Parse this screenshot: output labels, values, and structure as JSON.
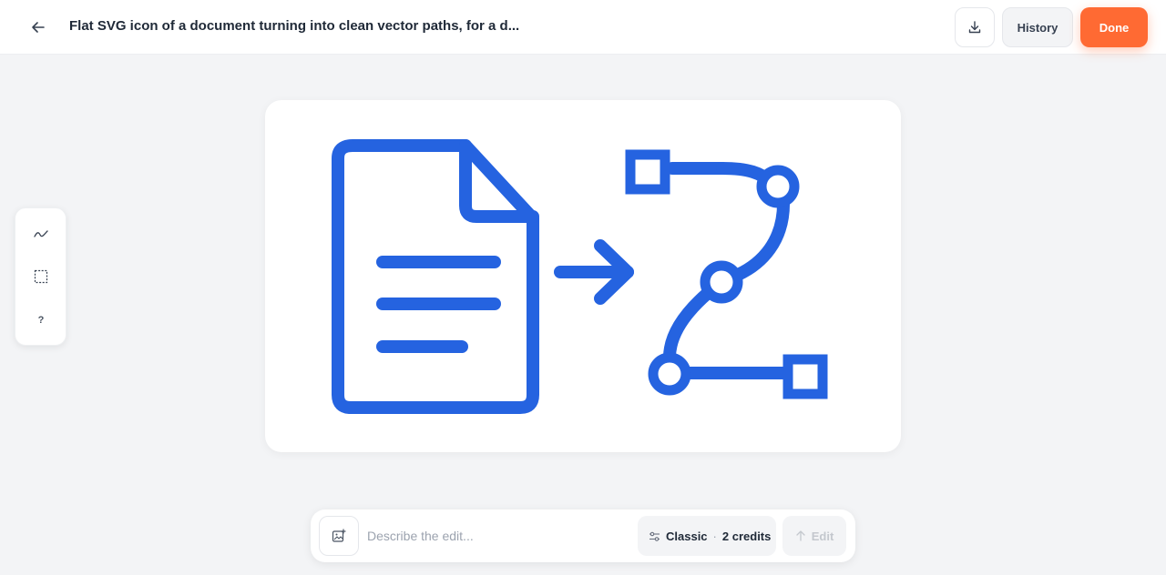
{
  "header": {
    "title": "Flat SVG icon of a document turning into clean vector paths, for a d...",
    "history_label": "History",
    "done_label": "Done"
  },
  "icons": {
    "back": "arrow-left-icon",
    "download": "download-icon",
    "path_tool": "path-tool-icon",
    "select_tool": "marquee-select-icon",
    "help": "help-icon",
    "attach": "image-add-icon",
    "mode": "sliders-icon",
    "submit": "arrow-up-icon"
  },
  "toolbar": {
    "help_label": "?"
  },
  "editbar": {
    "placeholder": "Describe the edit...",
    "mode_label": "Classic",
    "separator": "·",
    "credits_label": "2 credits",
    "submit_label": "Edit"
  },
  "colors": {
    "accent": "#ff6a33",
    "artwork_blue": "#2563e0",
    "background": "#f3f4f6"
  }
}
